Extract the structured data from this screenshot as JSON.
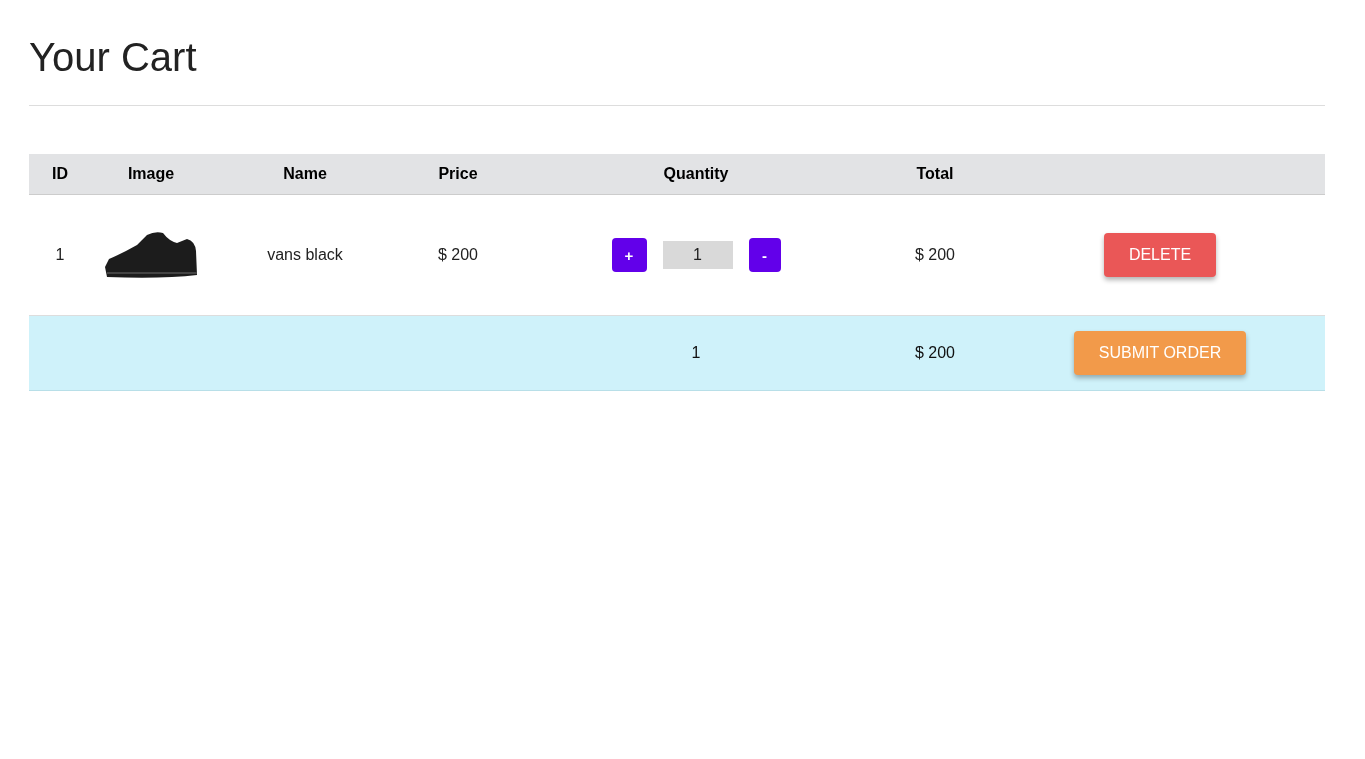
{
  "title": "Your Cart",
  "table": {
    "columns": [
      "ID",
      "Image",
      "Name",
      "Price",
      "Quantity",
      "Total"
    ],
    "rows": [
      {
        "id": "1",
        "name": "vans black",
        "price": "$ 200",
        "increment": "+",
        "quantity": "1",
        "decrement": "-",
        "total": "$ 200",
        "delete": "DELETE"
      }
    ],
    "summary": {
      "quantity": "1",
      "total": "$ 200",
      "submit": "SUBMIT ORDER"
    }
  }
}
